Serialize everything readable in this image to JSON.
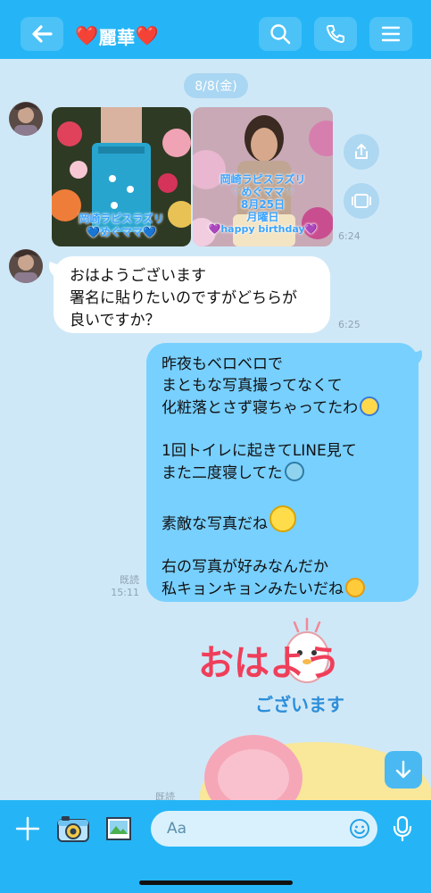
{
  "header": {
    "title": "麗華",
    "title_emoji_left": "❤️",
    "title_emoji_right": "❤️",
    "back_icon": "arrow-left-icon",
    "search_icon": "search-icon",
    "call_icon": "phone-icon",
    "menu_icon": "menu-icon"
  },
  "chat": {
    "date_label": "8/8(金)",
    "photos": [
      {
        "caption_line1": "岡崎ラピスラズリ",
        "caption_line2": "💙めぐママ💙"
      },
      {
        "caption_line1": "岡崎ラピスラズリ",
        "caption_line2": "♡めぐママ♡",
        "caption_line3": "8月25日",
        "caption_line4": "月曜日",
        "caption_line5": "💜happy birthday💜"
      }
    ],
    "photo_time": "6:24",
    "incoming_message": {
      "line1": "おはようございます",
      "line2": "署名に貼りたいのですがどちらが",
      "line3": "良いですか？",
      "time": "6:25"
    },
    "outgoing_message": {
      "line1": "昨夜もベロベロで",
      "line2": "まともな写真撮ってなくて",
      "line3": "化粧落とさず寝ちゃってたわ",
      "line4": "1回トイレに起きてLINE見て",
      "line5": "また二度寝してた",
      "line6": "素敵な写真だね",
      "line7": "右の写真が好みなんだか",
      "line8": "私キョンキョンみたいだね",
      "read_label": "既読",
      "time": "15:11"
    },
    "sticker": {
      "text_main": "おはよう",
      "text_sub": "ございます"
    },
    "partial_read": "既読"
  },
  "input_bar": {
    "placeholder": "Aa",
    "plus_icon": "plus-icon",
    "camera_icon": "camera-icon",
    "image_icon": "image-icon",
    "emoji_icon": "smiley-icon",
    "mic_icon": "microphone-icon"
  },
  "colors": {
    "header": "#25b5f6",
    "chat_bg": "#cfe8f7",
    "outgoing_bubble": "#78d0ff",
    "incoming_bubble": "#ffffff"
  }
}
